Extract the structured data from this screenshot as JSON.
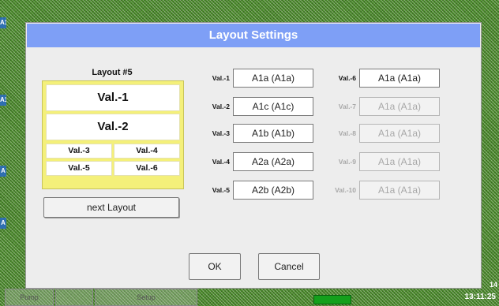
{
  "background": {
    "side_tabs": [
      "A1",
      "A1",
      "A",
      "A"
    ],
    "bottom_buttons": [
      "Pump",
      "",
      "Setup",
      ""
    ],
    "clock": "13:11:25",
    "date_fragment": "14"
  },
  "dialog": {
    "title": "Layout Settings",
    "layout": {
      "title": "Layout #5",
      "cells": [
        "Val.-1",
        "Val.-2",
        "Val.-3",
        "Val.-4",
        "Val.-5",
        "Val.-6"
      ],
      "next_button": "next Layout"
    },
    "values_left": [
      {
        "label": "Val.-1",
        "value": "A1a (A1a)"
      },
      {
        "label": "Val.-2",
        "value": "A1c (A1c)"
      },
      {
        "label": "Val.-3",
        "value": "A1b (A1b)"
      },
      {
        "label": "Val.-4",
        "value": "A2a (A2a)"
      },
      {
        "label": "Val.-5",
        "value": "A2b (A2b)"
      }
    ],
    "values_right": [
      {
        "label": "Val.-6",
        "value": "A1a (A1a)"
      },
      {
        "label": "Val.-7",
        "value": "A1a (A1a)"
      },
      {
        "label": "Val.-8",
        "value": "A1a (A1a)"
      },
      {
        "label": "Val.-9",
        "value": "A1a (A1a)"
      },
      {
        "label": "Val.-10",
        "value": "A1a (A1a)"
      }
    ],
    "ok_label": "OK",
    "cancel_label": "Cancel"
  },
  "colors": {
    "title_bar": "#7e9ff6",
    "layout_preview": "#f4f07a",
    "status_green": "#14a01c"
  }
}
